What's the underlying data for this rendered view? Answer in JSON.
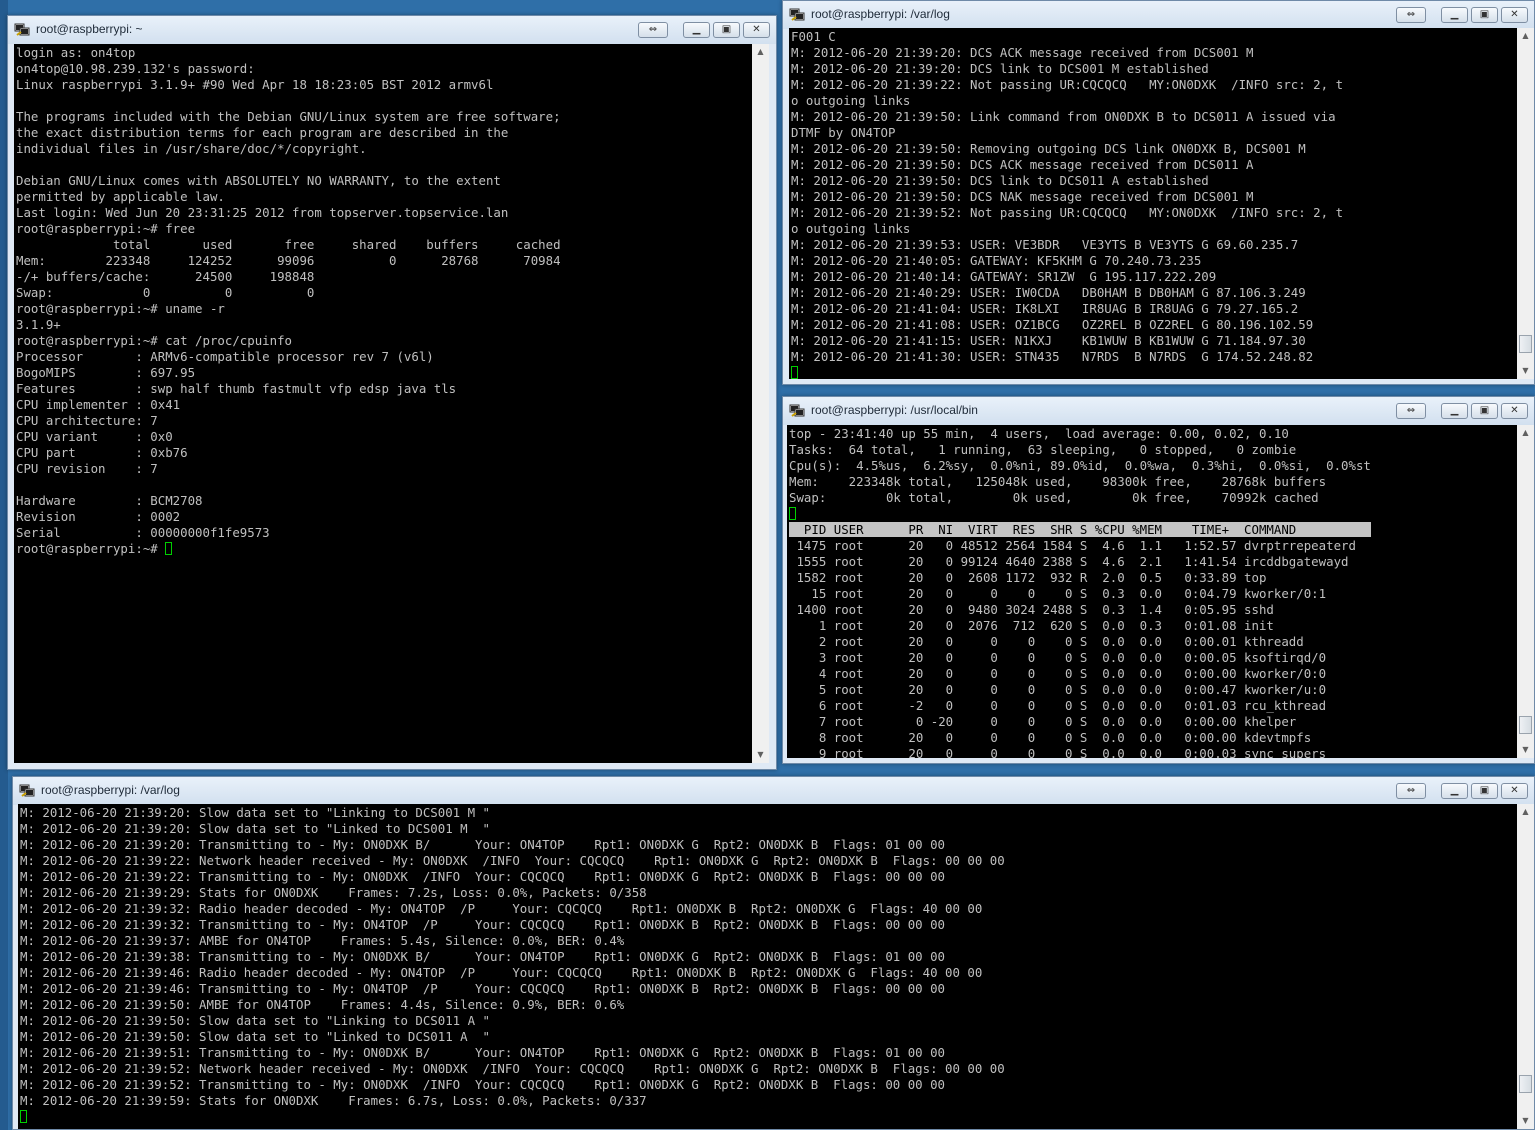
{
  "windows": {
    "w1": {
      "title": "root@raspberrypi: ~",
      "lines": [
        "login as: on4top",
        "on4top@10.98.239.132's password:",
        "Linux raspberrypi 3.1.9+ #90 Wed Apr 18 18:23:05 BST 2012 armv6l",
        "",
        "The programs included with the Debian GNU/Linux system are free software;",
        "the exact distribution terms for each program are described in the",
        "individual files in /usr/share/doc/*/copyright.",
        "",
        "Debian GNU/Linux comes with ABSOLUTELY NO WARRANTY, to the extent",
        "permitted by applicable law.",
        "Last login: Wed Jun 20 23:31:25 2012 from topserver.topservice.lan",
        "root@raspberrypi:~# free",
        "             total       used       free     shared    buffers     cached",
        "Mem:        223348     124252      99096          0      28768      70984",
        "-/+ buffers/cache:      24500     198848",
        "Swap:            0          0          0",
        "root@raspberrypi:~# uname -r",
        "3.1.9+",
        "root@raspberrypi:~# cat /proc/cpuinfo",
        "Processor       : ARMv6-compatible processor rev 7 (v6l)",
        "BogoMIPS        : 697.95",
        "Features        : swp half thumb fastmult vfp edsp java tls",
        "CPU implementer : 0x41",
        "CPU architecture: 7",
        "CPU variant     : 0x0",
        "CPU part        : 0xb76",
        "CPU revision    : 7",
        "",
        "Hardware        : BCM2708",
        "Revision        : 0002",
        "Serial          : 00000000f1fe9573"
      ],
      "prompt": "root@raspberrypi:~# "
    },
    "w2": {
      "title": "root@raspberrypi: /var/log",
      "lines": [
        "F001 C",
        "M: 2012-06-20 21:39:20: DCS ACK message received from DCS001 M",
        "M: 2012-06-20 21:39:20: DCS link to DCS001 M established",
        "M: 2012-06-20 21:39:22: Not passing UR:CQCQCQ   MY:ON0DXK  /INFO src: 2, t",
        "o outgoing links",
        "M: 2012-06-20 21:39:50: Link command from ON0DXK B to DCS011 A issued via",
        "DTMF by ON4TOP",
        "M: 2012-06-20 21:39:50: Removing outgoing DCS link ON0DXK B, DCS001 M",
        "M: 2012-06-20 21:39:50: DCS ACK message received from DCS011 A",
        "M: 2012-06-20 21:39:50: DCS link to DCS011 A established",
        "M: 2012-06-20 21:39:50: DCS NAK message received from DCS001 M",
        "M: 2012-06-20 21:39:52: Not passing UR:CQCQCQ   MY:ON0DXK  /INFO src: 2, t",
        "o outgoing links",
        "M: 2012-06-20 21:39:53: USER: VE3BDR   VE3YTS B VE3YTS G 69.60.235.7",
        "M: 2012-06-20 21:40:05: GATEWAY: KF5KHM G 70.240.73.235",
        "M: 2012-06-20 21:40:14: GATEWAY: SR1ZW  G 195.117.222.209",
        "M: 2012-06-20 21:40:29: USER: IW0CDA   DB0HAM B DB0HAM G 87.106.3.249",
        "M: 2012-06-20 21:41:04: USER: IK8LXI   IR8UAG B IR8UAG G 79.27.165.2",
        "M: 2012-06-20 21:41:08: USER: OZ1BCG   OZ2REL B OZ2REL G 80.196.102.59",
        "M: 2012-06-20 21:41:15: USER: N1KXJ    KB1WUW B KB1WUW G 71.184.97.30",
        "M: 2012-06-20 21:41:30: USER: STN435   N7RDS  B N7RDS  G 174.52.248.82"
      ]
    },
    "w3": {
      "title": "root@raspberrypi: /usr/local/bin",
      "summary": [
        "top - 23:41:40 up 55 min,  4 users,  load average: 0.00, 0.02, 0.10",
        "Tasks:  64 total,   1 running,  63 sleeping,   0 stopped,   0 zombie",
        "Cpu(s):  4.5%us,  6.2%sy,  0.0%ni, 89.0%id,  0.0%wa,  0.3%hi,  0.0%si,  0.0%st",
        "Mem:    223348k total,   125048k used,    98300k free,    28768k buffers",
        "Swap:        0k total,        0k used,        0k free,    70992k cached"
      ],
      "header": "  PID USER      PR  NI  VIRT  RES  SHR S %CPU %MEM    TIME+  COMMAND          ",
      "rows": [
        " 1475 root      20   0 48512 2564 1584 S  4.6  1.1   1:52.57 dvrptrrepeaterd",
        " 1555 root      20   0 99124 4640 2388 S  4.6  2.1   1:41.54 ircddbgatewayd",
        " 1582 root      20   0  2608 1172  932 R  2.0  0.5   0:33.89 top",
        "   15 root      20   0     0    0    0 S  0.3  0.0   0:04.79 kworker/0:1",
        " 1400 root      20   0  9480 3024 2488 S  0.3  1.4   0:05.95 sshd",
        "    1 root      20   0  2076  712  620 S  0.0  0.3   0:01.08 init",
        "    2 root      20   0     0    0    0 S  0.0  0.0   0:00.01 kthreadd",
        "    3 root      20   0     0    0    0 S  0.0  0.0   0:00.05 ksoftirqd/0",
        "    4 root      20   0     0    0    0 S  0.0  0.0   0:00.00 kworker/0:0",
        "    5 root      20   0     0    0    0 S  0.0  0.0   0:00.47 kworker/u:0",
        "    6 root      -2   0     0    0    0 S  0.0  0.0   0:01.03 rcu_kthread",
        "    7 root       0 -20     0    0    0 S  0.0  0.0   0:00.00 khelper",
        "    8 root      20   0     0    0    0 S  0.0  0.0   0:00.00 kdevtmpfs",
        "    9 root      20   0     0    0    0 S  0.0  0.0   0:00.03 sync_supers"
      ]
    },
    "w4": {
      "title": "root@raspberrypi: /var/log",
      "lines": [
        "M: 2012-06-20 21:39:20: Slow data set to \"Linking to DCS001 M \"",
        "M: 2012-06-20 21:39:20: Slow data set to \"Linked to DCS001 M  \"",
        "M: 2012-06-20 21:39:20: Transmitting to - My: ON0DXK B/      Your: ON4TOP    Rpt1: ON0DXK G  Rpt2: ON0DXK B  Flags: 01 00 00",
        "M: 2012-06-20 21:39:22: Network header received - My: ON0DXK  /INFO  Your: CQCQCQ    Rpt1: ON0DXK G  Rpt2: ON0DXK B  Flags: 00 00 00",
        "M: 2012-06-20 21:39:22: Transmitting to - My: ON0DXK  /INFO  Your: CQCQCQ    Rpt1: ON0DXK G  Rpt2: ON0DXK B  Flags: 00 00 00",
        "M: 2012-06-20 21:39:29: Stats for ON0DXK    Frames: 7.2s, Loss: 0.0%, Packets: 0/358",
        "M: 2012-06-20 21:39:32: Radio header decoded - My: ON4TOP  /P     Your: CQCQCQ    Rpt1: ON0DXK B  Rpt2: ON0DXK G  Flags: 40 00 00",
        "M: 2012-06-20 21:39:32: Transmitting to - My: ON4TOP  /P     Your: CQCQCQ    Rpt1: ON0DXK B  Rpt2: ON0DXK B  Flags: 00 00 00",
        "M: 2012-06-20 21:39:37: AMBE for ON4TOP    Frames: 5.4s, Silence: 0.0%, BER: 0.4%",
        "M: 2012-06-20 21:39:38: Transmitting to - My: ON0DXK B/      Your: ON4TOP    Rpt1: ON0DXK G  Rpt2: ON0DXK B  Flags: 01 00 00",
        "M: 2012-06-20 21:39:46: Radio header decoded - My: ON4TOP  /P     Your: CQCQCQ    Rpt1: ON0DXK B  Rpt2: ON0DXK G  Flags: 40 00 00",
        "M: 2012-06-20 21:39:46: Transmitting to - My: ON4TOP  /P     Your: CQCQCQ    Rpt1: ON0DXK B  Rpt2: ON0DXK B  Flags: 00 00 00",
        "M: 2012-06-20 21:39:50: AMBE for ON4TOP    Frames: 4.4s, Silence: 0.9%, BER: 0.6%",
        "M: 2012-06-20 21:39:50: Slow data set to \"Linking to DCS011 A \"",
        "M: 2012-06-20 21:39:50: Slow data set to \"Linked to DCS011 A  \"",
        "M: 2012-06-20 21:39:51: Transmitting to - My: ON0DXK B/      Your: ON4TOP    Rpt1: ON0DXK G  Rpt2: ON0DXK B  Flags: 01 00 00",
        "M: 2012-06-20 21:39:52: Network header received - My: ON0DXK  /INFO  Your: CQCQCQ    Rpt1: ON0DXK G  Rpt2: ON0DXK B  Flags: 00 00 00",
        "M: 2012-06-20 21:39:52: Transmitting to - My: ON0DXK  /INFO  Your: CQCQCQ    Rpt1: ON0DXK G  Rpt2: ON0DXK B  Flags: 00 00 00",
        "M: 2012-06-20 21:39:59: Stats for ON0DXK    Frames: 6.7s, Loss: 0.0%, Packets: 0/337"
      ]
    }
  },
  "icons": {
    "window": "putty-icon",
    "restore": "restore-icon",
    "minimize": "minimize-icon",
    "maximize": "maximize-icon",
    "close": "close-icon"
  },
  "colors": {
    "terminal_bg": "#000000",
    "terminal_fg": "#c0c0c0",
    "cursor": "#00d000",
    "top_header_bg": "#c4c4c4",
    "titlebar": "#dfe9f5"
  }
}
